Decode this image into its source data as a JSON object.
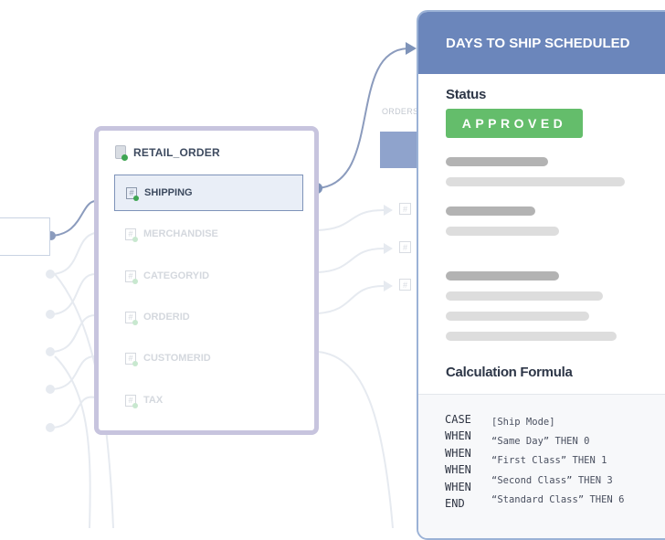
{
  "table": {
    "name": "RETAIL_ORDER",
    "fields": [
      {
        "name": "SHIPPING",
        "selected": true
      },
      {
        "name": "MERCHANDISE",
        "selected": false
      },
      {
        "name": "CATEGORYID",
        "selected": false
      },
      {
        "name": "ORDERID",
        "selected": false
      },
      {
        "name": "CUSTOMERID",
        "selected": false
      },
      {
        "name": "TAX",
        "selected": false
      }
    ],
    "field_icon": "#"
  },
  "orders_label": "ORDERS",
  "panel": {
    "title": "DAYS TO SHIP SCHEDULED",
    "status_label": "Status",
    "status_value": "APPROVED",
    "formula_label": "Calculation Formula",
    "formula": {
      "keywords": [
        "CASE",
        "WHEN",
        "WHEN",
        "WHEN",
        "WHEN",
        "END"
      ],
      "clauses": [
        "[Ship Mode]",
        "“Same Day” THEN 0",
        "“First Class” THEN 1",
        "“Second Class” THEN 3",
        "“Standard Class” THEN 6"
      ]
    }
  },
  "colors": {
    "panel_header": "#6b86bb",
    "approved": "#64bd6b",
    "table_border": "#c7c4de",
    "selected_row": "#e9eef7",
    "connector": "#7e93b9",
    "status_dot": "#3ea552"
  },
  "icons": {
    "table": "file-icon",
    "field": "hash-icon",
    "arrow": "arrow-right-icon"
  }
}
